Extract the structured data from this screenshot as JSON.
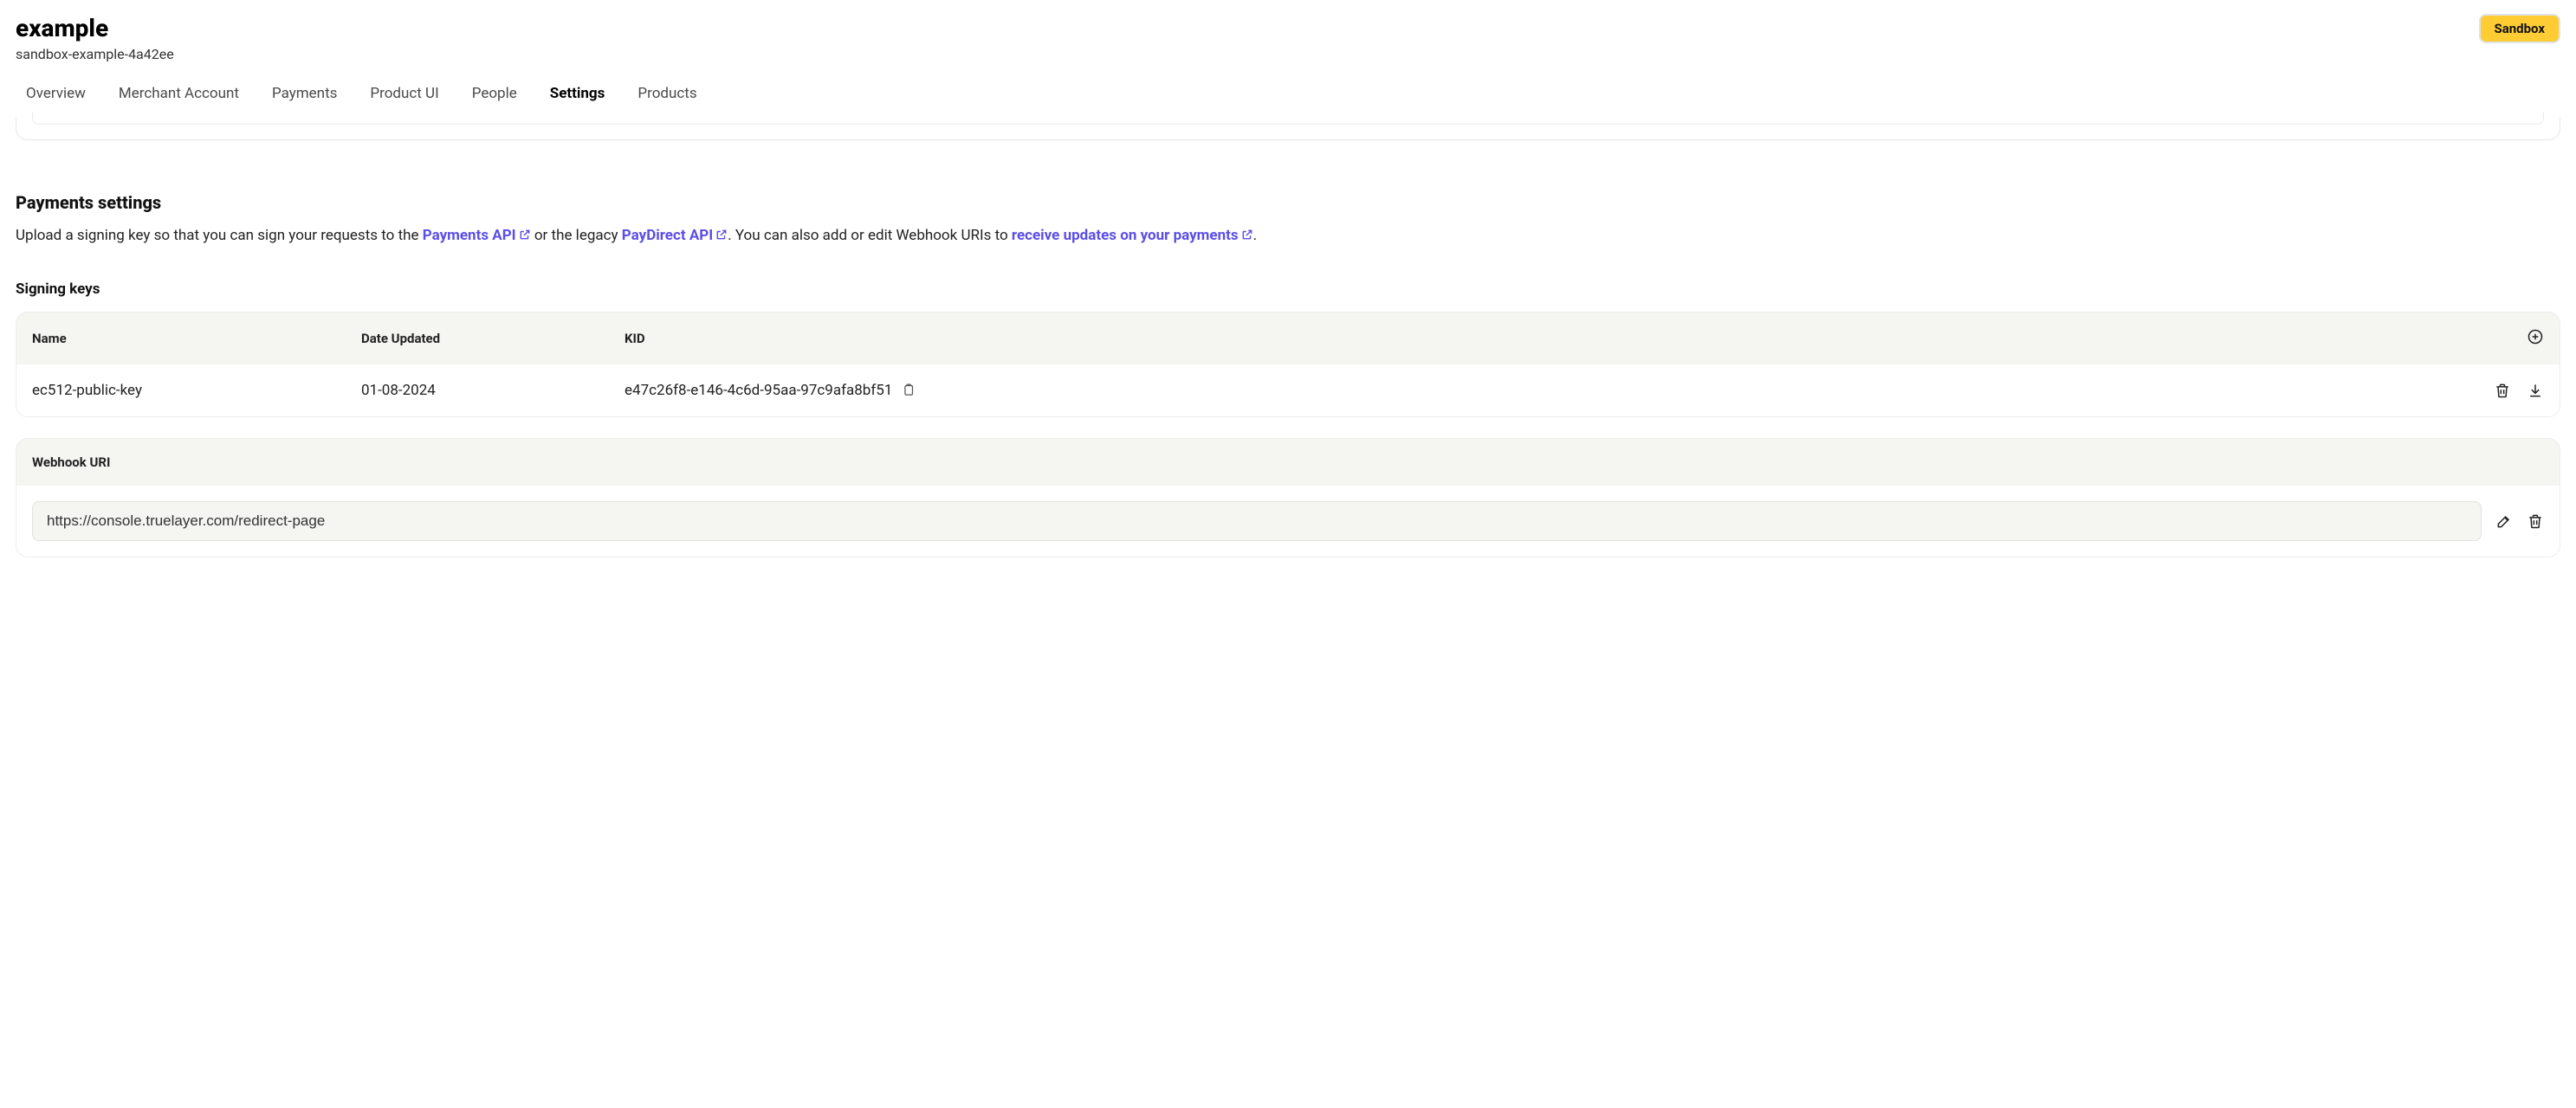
{
  "header": {
    "title": "example",
    "subtitle": "sandbox-example-4a42ee",
    "badge": "Sandbox"
  },
  "tabs": [
    {
      "label": "Overview",
      "active": false
    },
    {
      "label": "Merchant Account",
      "active": false
    },
    {
      "label": "Payments",
      "active": false
    },
    {
      "label": "Product UI",
      "active": false
    },
    {
      "label": "People",
      "active": false
    },
    {
      "label": "Settings",
      "active": true
    },
    {
      "label": "Products",
      "active": false
    }
  ],
  "payments_settings": {
    "title": "Payments settings",
    "desc_part1": "Upload a signing key so that you can sign your requests to the ",
    "link1": "Payments API",
    "desc_part2": " or the legacy ",
    "link2": "PayDirect API",
    "desc_part3": ". You can also add or edit Webhook URIs to ",
    "link3": "receive updates on your payments",
    "desc_part4": "."
  },
  "signing_keys": {
    "title": "Signing keys",
    "columns": {
      "name": "Name",
      "date_updated": "Date Updated",
      "kid": "KID"
    },
    "rows": [
      {
        "name": "ec512-public-key",
        "date_updated": "01-08-2024",
        "kid": "e47c26f8-e146-4c6d-95aa-97c9afa8bf51"
      }
    ]
  },
  "webhook": {
    "title": "Webhook URI",
    "value": "https://console.truelayer.com/redirect-page"
  }
}
